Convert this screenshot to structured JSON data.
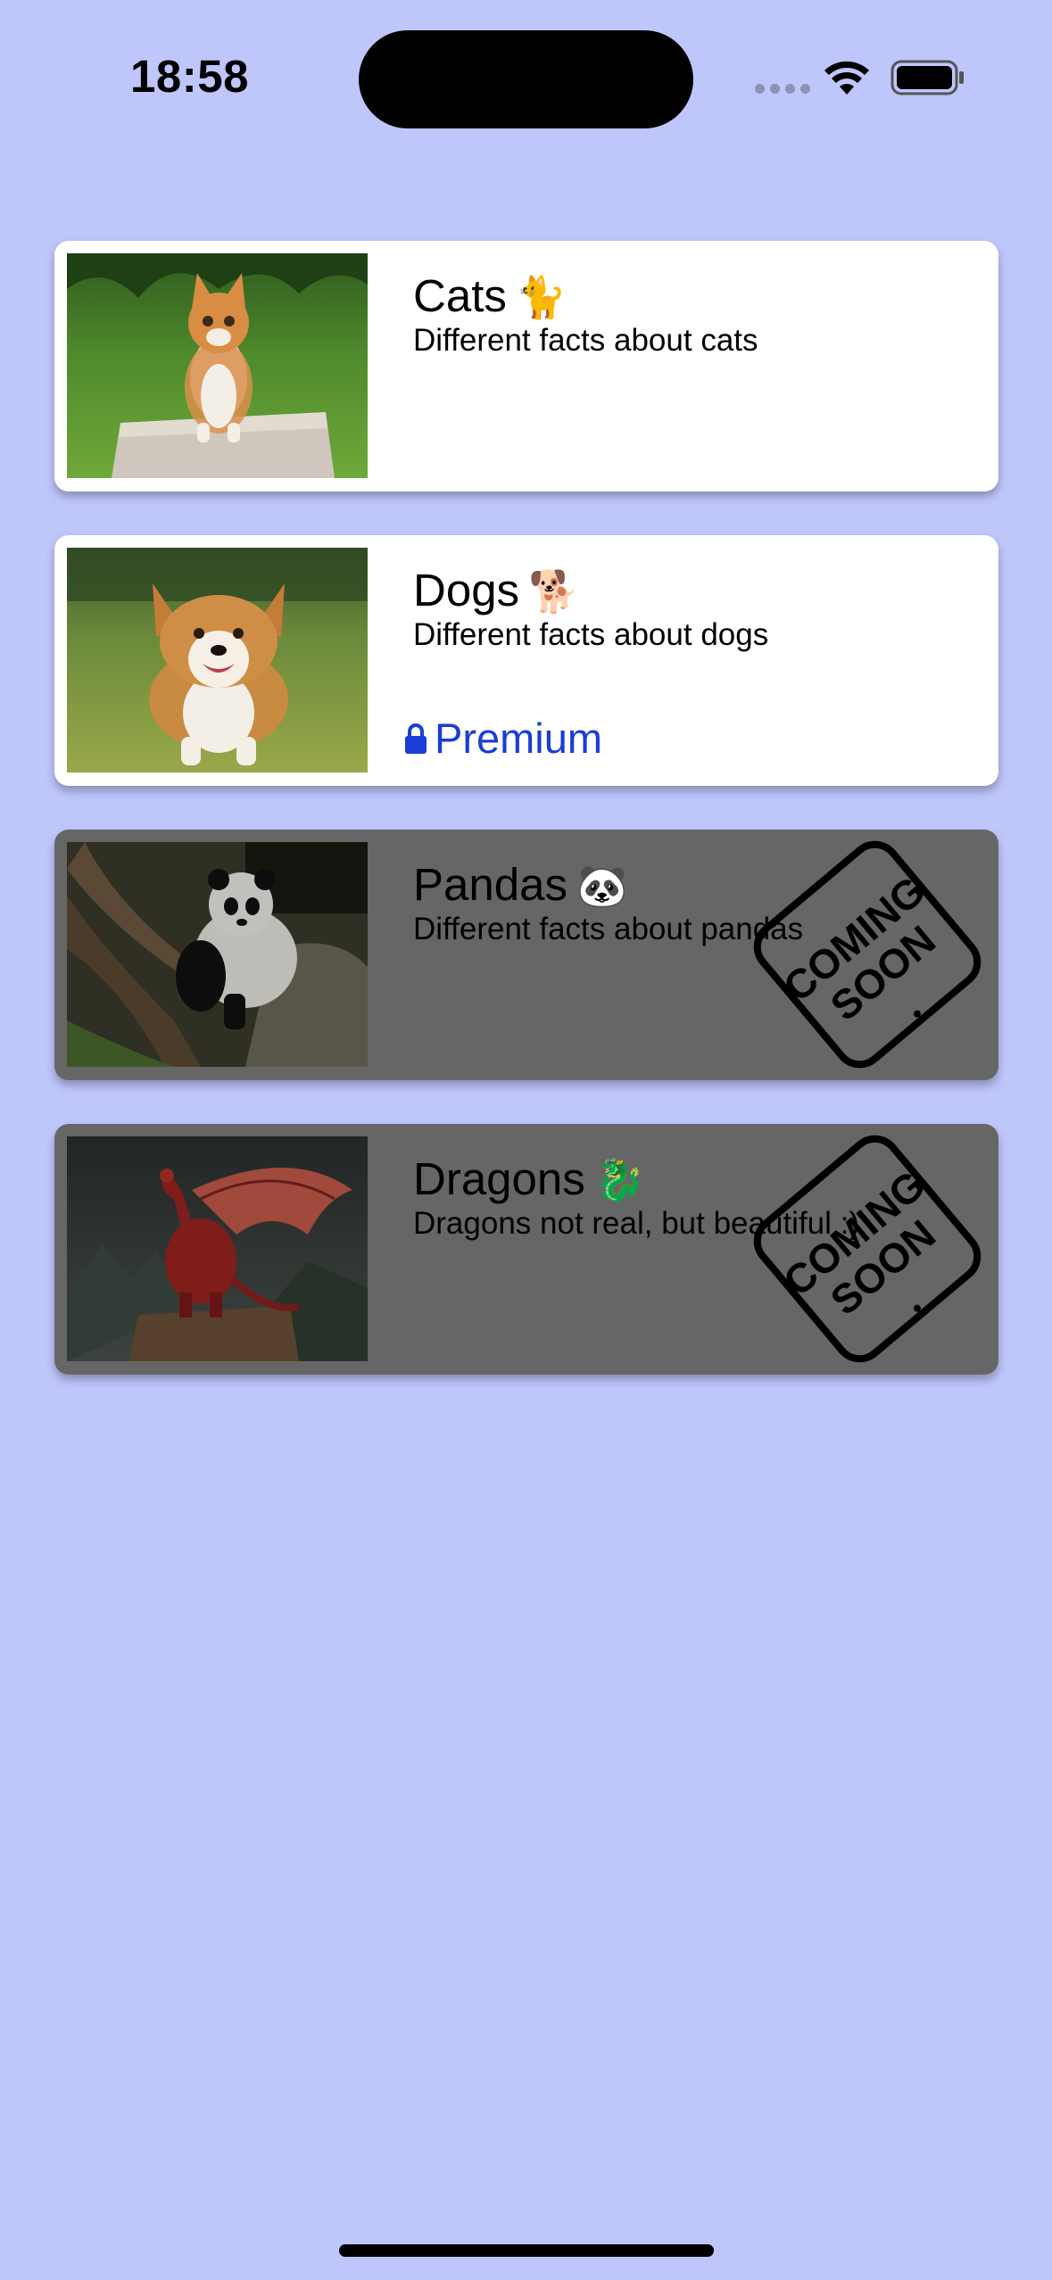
{
  "status_bar": {
    "time": "18:58"
  },
  "cards": [
    {
      "title": "Cats",
      "emoji": "🐈",
      "subtitle": "Different facts about cats",
      "image_icon": "cat-photo",
      "state": "available"
    },
    {
      "title": "Dogs",
      "emoji": "🐕",
      "subtitle": "Different facts about dogs",
      "image_icon": "dog-photo",
      "state": "premium",
      "badge_label": "Premium",
      "badge_icon": "lock-icon"
    },
    {
      "title": "Pandas",
      "emoji": "🐼",
      "subtitle": "Different facts about pandas",
      "image_icon": "panda-photo",
      "state": "coming-soon",
      "stamp_line1": "COMING",
      "stamp_line2": "SOON"
    },
    {
      "title": "Dragons",
      "emoji": "🐉",
      "subtitle": "Dragons not real, but beautiful :)",
      "image_icon": "dragon-photo",
      "state": "coming-soon",
      "stamp_line1": "COMING",
      "stamp_line2": "SOON"
    }
  ],
  "colors": {
    "background": "#bfc6fc",
    "card": "#ffffff",
    "card_disabled": "#666666",
    "premium_accent": "#1a3dd6"
  }
}
